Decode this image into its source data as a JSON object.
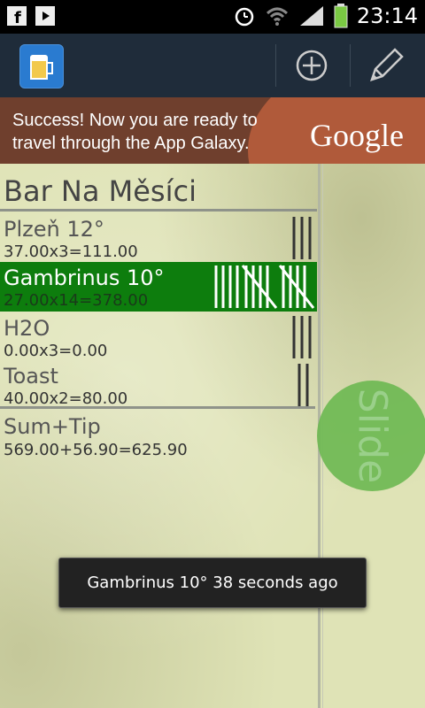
{
  "status_bar": {
    "time": "23:14",
    "icons": [
      "facebook-icon",
      "youtube-icon",
      "alarm-icon",
      "wifi-icon",
      "signal-icon",
      "battery-icon"
    ]
  },
  "action_bar": {
    "app_icon": "beer-mug-icon",
    "actions": [
      "add-icon",
      "edit-pencil-icon"
    ]
  },
  "ad": {
    "text": "Success! Now you are ready to travel through the App Galaxy.",
    "brand": "Google"
  },
  "bar": {
    "name": "Bar Na Měsíci",
    "items": [
      {
        "name": "Plzeň 12°",
        "total": "37.00x3=111.00",
        "count": 3,
        "selected": false
      },
      {
        "name": "Gambrinus 10°",
        "total": "27.00x14=378.00",
        "count": 14,
        "selected": true
      },
      {
        "name": "H2O",
        "total": "0.00x3=0.00",
        "count": 3,
        "selected": false
      },
      {
        "name": "Toast",
        "total": "40.00x2=80.00",
        "count": 2,
        "selected": false
      }
    ],
    "sum_label": "Sum+Tip",
    "sum_value": "569.00+56.90=625.90"
  },
  "slide_label": "Slide",
  "toast": "Gambrinus 10° 38 seconds ago",
  "colors": {
    "selected_row": "#0d7d0d",
    "paper": "#dfe3b6",
    "action_bar": "#1f2c3a"
  }
}
